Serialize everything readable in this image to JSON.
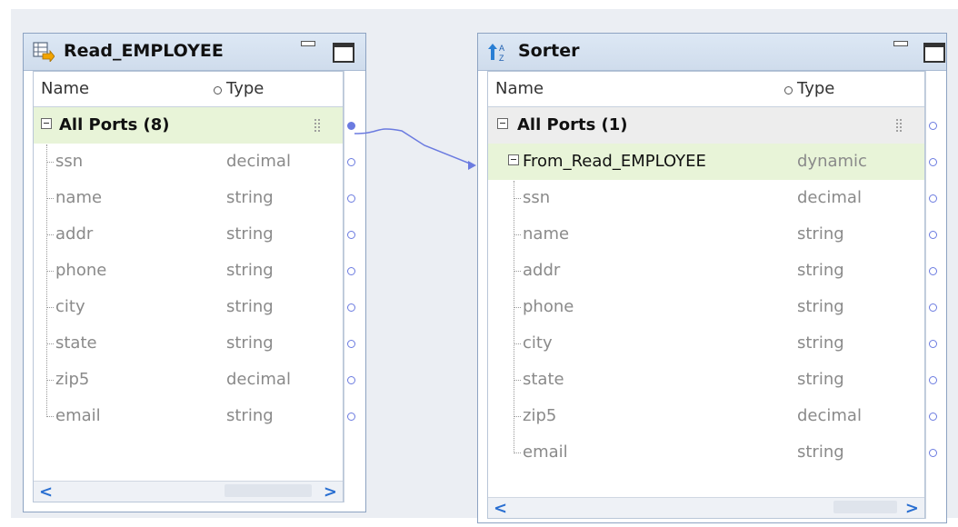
{
  "left": {
    "title": "Read_EMPLOYEE",
    "col_name": "Name",
    "col_type": "Type",
    "group": "All Ports (8)",
    "rows": [
      {
        "name": "ssn",
        "type": "decimal"
      },
      {
        "name": "name",
        "type": "string"
      },
      {
        "name": "addr",
        "type": "string"
      },
      {
        "name": "phone",
        "type": "string"
      },
      {
        "name": "city",
        "type": "string"
      },
      {
        "name": "state",
        "type": "string"
      },
      {
        "name": "zip5",
        "type": "decimal"
      },
      {
        "name": "email",
        "type": "string"
      }
    ],
    "icon": "read-object-icon"
  },
  "right": {
    "title": "Sorter",
    "col_name": "Name",
    "col_type": "Type",
    "group": "All Ports (1)",
    "subgroup": {
      "name": "From_Read_EMPLOYEE",
      "type": "dynamic"
    },
    "rows": [
      {
        "name": "ssn",
        "type": "decimal"
      },
      {
        "name": "name",
        "type": "string"
      },
      {
        "name": "addr",
        "type": "string"
      },
      {
        "name": "phone",
        "type": "string"
      },
      {
        "name": "city",
        "type": "string"
      },
      {
        "name": "state",
        "type": "string"
      },
      {
        "name": "zip5",
        "type": "decimal"
      },
      {
        "name": "email",
        "type": "string"
      }
    ],
    "icon": "sorter-icon"
  },
  "scroll_left_glyph": "<",
  "scroll_right_glyph": ">",
  "colors": {
    "link": "#6b7be0",
    "highlight": "#e8f4d8",
    "header": "#d4e1ef"
  }
}
